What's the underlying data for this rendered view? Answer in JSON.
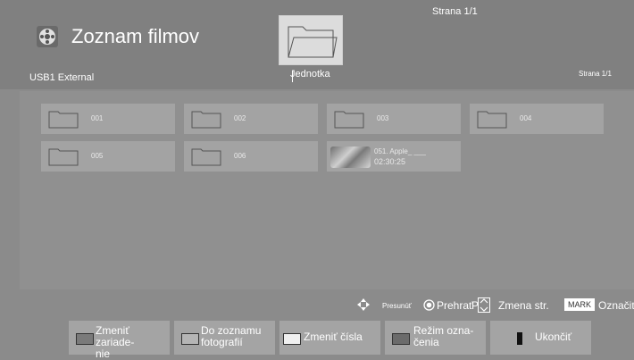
{
  "header": {
    "title": "Zoznam filmov",
    "page_top": "Strana 1/1",
    "source": "USB1 External",
    "path": "Jednotka",
    "page_right": "Strana 1/1"
  },
  "items": [
    {
      "label": "001",
      "type": "folder"
    },
    {
      "label": "002",
      "type": "folder"
    },
    {
      "label": "003",
      "type": "folder"
    },
    {
      "label": "004",
      "type": "folder"
    },
    {
      "label": "005",
      "type": "folder"
    },
    {
      "label": "006",
      "type": "folder"
    },
    {
      "label": "051. Apple_ ___",
      "duration": "02:30:25",
      "type": "video"
    }
  ],
  "hints": {
    "move": "Presunúť",
    "play": "Prehrať",
    "p": "P",
    "page_change": "Zmena str.",
    "mark_key": "MARK",
    "mark": "Označiť"
  },
  "buttons": {
    "change_device_1": "Zmeniť zariade-",
    "change_device_2": "nie",
    "photo_list_1": "Do zoznamu",
    "photo_list_2": "fotografií",
    "change_numbers": "Zmeniť čísla",
    "mark_mode_1": "Režim ozna-",
    "mark_mode_2": "čenia",
    "exit": "Ukončiť"
  },
  "colors": {
    "background": "#8b8b8b",
    "tile": "#a3a3a3",
    "button": "#a4a4a4"
  }
}
